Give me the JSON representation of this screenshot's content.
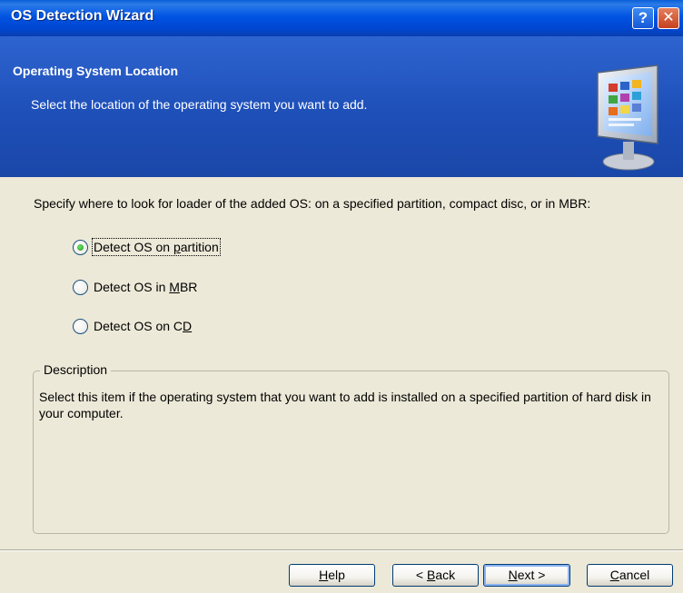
{
  "window": {
    "title": "OS Detection Wizard",
    "help_glyph": "?",
    "close_glyph": "✕"
  },
  "header": {
    "title": "Operating System Location",
    "subtitle": "Select the location of the operating system you want to add.",
    "icon": "monitor-icon"
  },
  "instruction": "Specify where to look for loader of the added OS: on a specified partition, compact disc, or in MBR:",
  "options": [
    {
      "label_pre": "Detect OS on ",
      "label_key": "p",
      "label_post": "artition",
      "selected": true
    },
    {
      "label_pre": "Detect OS in ",
      "label_key": "M",
      "label_post": "BR",
      "selected": false
    },
    {
      "label_pre": "Detect OS on C",
      "label_key": "D",
      "label_post": "",
      "selected": false
    }
  ],
  "description": {
    "legend": "Description",
    "text": "Select this item if the operating system that you want to add is installed on a specified partition of hard disk in your computer."
  },
  "buttons": {
    "help": {
      "key": "H",
      "rest": "elp"
    },
    "back": {
      "pre": "< ",
      "key": "B",
      "rest": "ack"
    },
    "next": {
      "key": "N",
      "rest": "ext >"
    },
    "cancel": {
      "key": "C",
      "rest": "ancel"
    }
  },
  "colors": {
    "titlebar": "#0054e3",
    "header": "#2e64d0",
    "face": "#ece9d8",
    "radio_selected": "#1e9a18"
  }
}
